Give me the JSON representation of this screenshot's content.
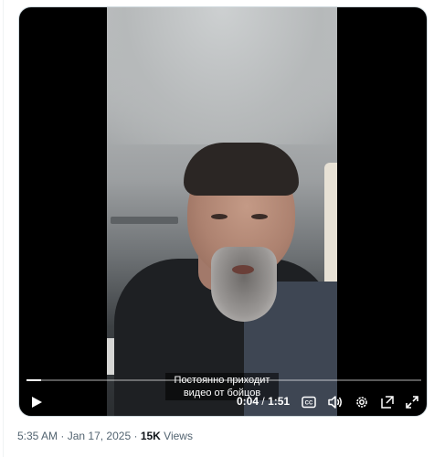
{
  "video": {
    "subtitle_line1": "Постоянно приходит",
    "subtitle_line2": "видео от бойцов",
    "current_time": "0:04",
    "time_separator": "/",
    "duration": "1:51",
    "progress_fraction": 0.036
  },
  "controls": {
    "play_icon": "play-icon",
    "captions_icon": "captions-icon",
    "volume_icon": "volume-icon",
    "settings_icon": "gear-icon",
    "popout_icon": "popout-icon",
    "fullscreen_icon": "fullscreen-icon"
  },
  "post_meta": {
    "time": "5:35 AM",
    "dot1": "·",
    "date": "Jan 17, 2025",
    "dot2": "·",
    "views_count": "15K",
    "views_label": "Views"
  },
  "colors": {
    "meta_text": "#536471",
    "views_text": "#0f1419",
    "player_bg": "#000000"
  }
}
